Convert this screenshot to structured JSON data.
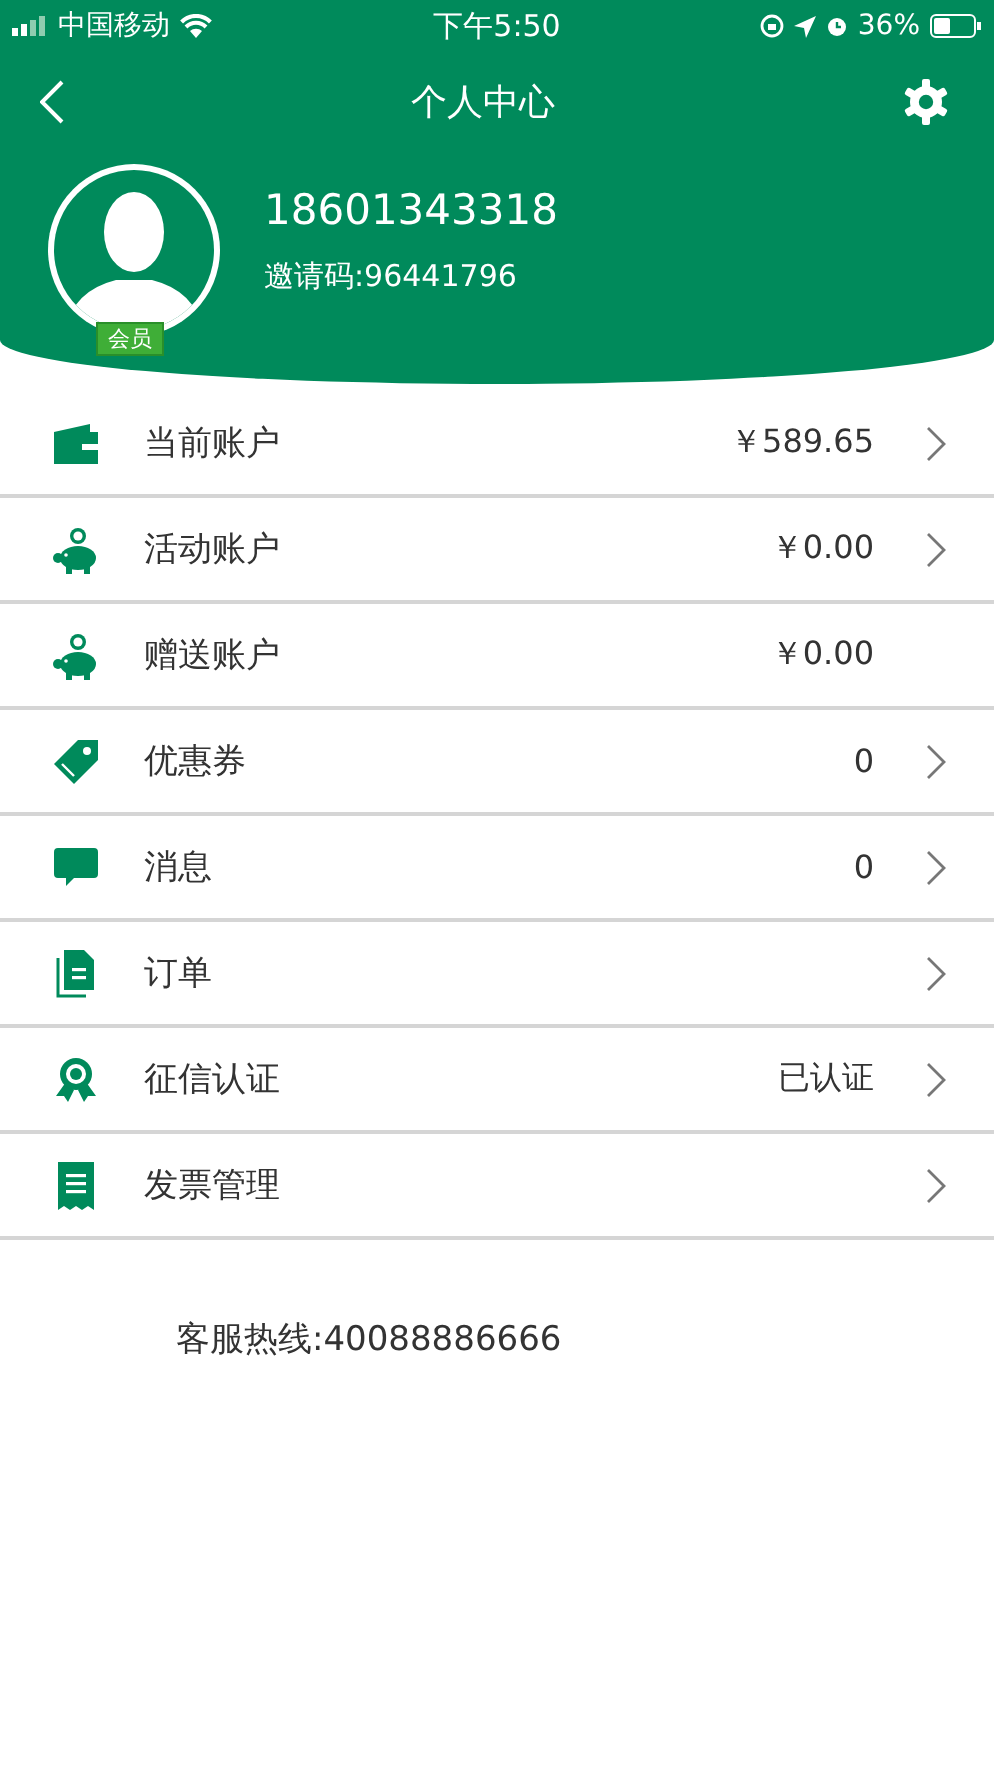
{
  "status_bar": {
    "carrier": "中国移动",
    "time": "下午5:50",
    "battery": "36%"
  },
  "nav": {
    "title": "个人中心"
  },
  "profile": {
    "phone": "18601343318",
    "invite": "邀请码:96441796",
    "badge": "会员"
  },
  "rows": [
    {
      "kind": "wallet",
      "label": "当前账户",
      "value": "￥589.65",
      "arrow": true
    },
    {
      "kind": "piggy",
      "label": "活动账户",
      "value": "￥0.00",
      "arrow": true
    },
    {
      "kind": "piggy",
      "label": "赠送账户",
      "value": "￥0.00",
      "arrow": false
    },
    {
      "kind": "tag",
      "label": "优惠券",
      "value": "0",
      "arrow": true
    },
    {
      "kind": "chat",
      "label": "消息",
      "value": "0",
      "arrow": true
    },
    {
      "kind": "document",
      "label": "订单",
      "arrow": true
    },
    {
      "kind": "award",
      "label": "征信认证",
      "value": "已认证",
      "arrow": true
    },
    {
      "kind": "receipt",
      "label": "发票管理",
      "arrow": true
    }
  ],
  "hotline": "客服热线:40088886666"
}
